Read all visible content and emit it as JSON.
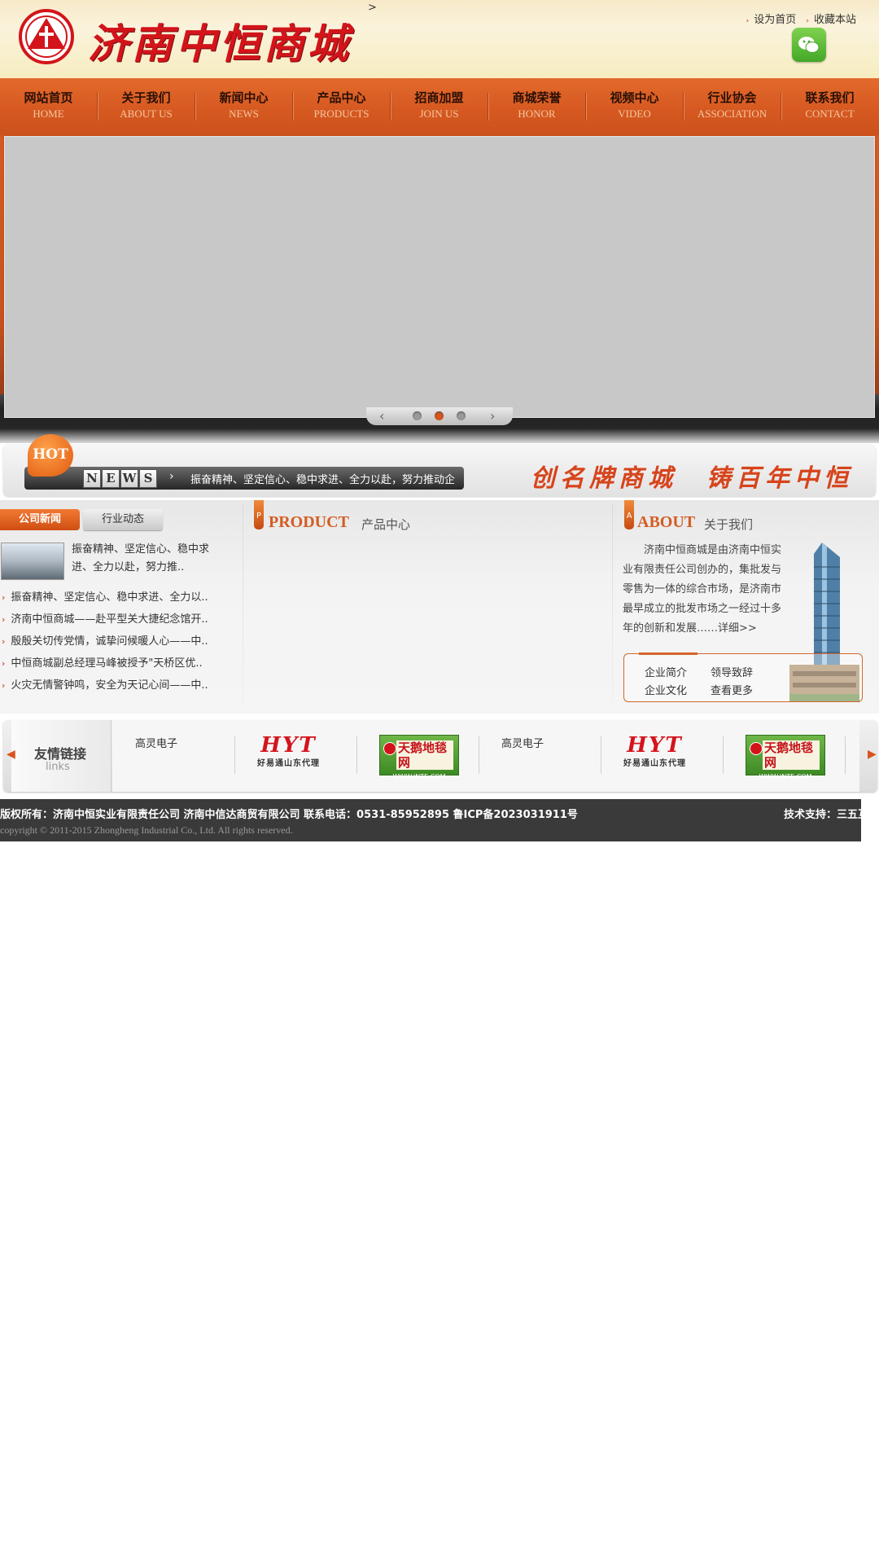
{
  "header": {
    "logo_text": "济南中恒商城",
    "gt": ">",
    "set_home": "设为首页",
    "bookmark": "收藏本站",
    "wechat_icon": "wechat-icon"
  },
  "nav": [
    {
      "zh": "网站首页",
      "en": "HOME"
    },
    {
      "zh": "关于我们",
      "en": "ABOUT US"
    },
    {
      "zh": "新闻中心",
      "en": "NEWS"
    },
    {
      "zh": "产品中心",
      "en": "PRODUCTS"
    },
    {
      "zh": "招商加盟",
      "en": "JOIN US"
    },
    {
      "zh": "商城荣誉",
      "en": "HONOR"
    },
    {
      "zh": "视频中心",
      "en": "VIDEO"
    },
    {
      "zh": "行业协会",
      "en": "ASSOCIATION"
    },
    {
      "zh": "联系我们",
      "en": "CONTACT"
    }
  ],
  "slider": {
    "prev": "‹",
    "next": "›",
    "active_index": 1,
    "dot_count": 3
  },
  "hot": {
    "badge": "HOT",
    "letters": [
      "N",
      "E",
      "W",
      "S"
    ],
    "arrow": "›",
    "ticker": "振奋精神、坚定信心、稳中求进、全力以赴，努力推动企",
    "slogan": "创名牌商城　铸百年中恒"
  },
  "news": {
    "tab_company": "公司新闻",
    "tab_industry": "行业动态",
    "feature_text": "振奋精神、坚定信心、稳中求进、全力以赴，努力推..",
    "items": [
      "振奋精神、坚定信心、稳中求进、全力以..",
      "济南中恒商城——赴平型关大捷纪念馆开..",
      "殷殷关切传党情，诚挚问候暖人心——中..",
      "中恒商城副总经理马峰被授予\"天桥区优..",
      "火灾无情警钟鸣，安全为天记心间——中.."
    ]
  },
  "product": {
    "tag": "P",
    "en": "PRODUCT",
    "zh": "产品中心"
  },
  "about": {
    "tag": "A",
    "en": "ABOUT",
    "zh": "关于我们",
    "text": "济南中恒商城是由济南中恒实业有限责任公司创办的，集批发与零售为一体的综合市场，是济南市最早成立的批发市场之一经过十多年的创新和发展……详细>>",
    "links": [
      "企业简介",
      "领导致辞",
      "企业文化",
      "查看更多"
    ]
  },
  "links": {
    "title": "友情链接",
    "sub": "links",
    "partners": [
      {
        "type": "alt",
        "text": "高灵电子"
      },
      {
        "type": "hyt",
        "text": "HYT",
        "sub": "好易通山东代理"
      },
      {
        "type": "tian",
        "text": "天鹅地毯网",
        "sub": "WWW.JNTE.COM"
      },
      {
        "type": "alt",
        "text": "高灵电子"
      },
      {
        "type": "hyt",
        "text": "HYT",
        "sub": "好易通山东代理"
      },
      {
        "type": "tian",
        "text": "天鹅地毯网",
        "sub": "WWW.JNTE.COM"
      }
    ]
  },
  "footer": {
    "line1": "版权所有：济南中恒实业有限责任公司  济南中信达商贸有限公司  联系电话：0531-85952895  鲁ICP备2023031911号",
    "support": "技术支持：三五互联",
    "line2": "copyright © 2011-2015  Zhongheng Industrial Co., Ltd. All rights reserved."
  },
  "colors": {
    "accent": "#d65921",
    "footer": "#3a3a3a",
    "banner": "#c8c8c8"
  }
}
